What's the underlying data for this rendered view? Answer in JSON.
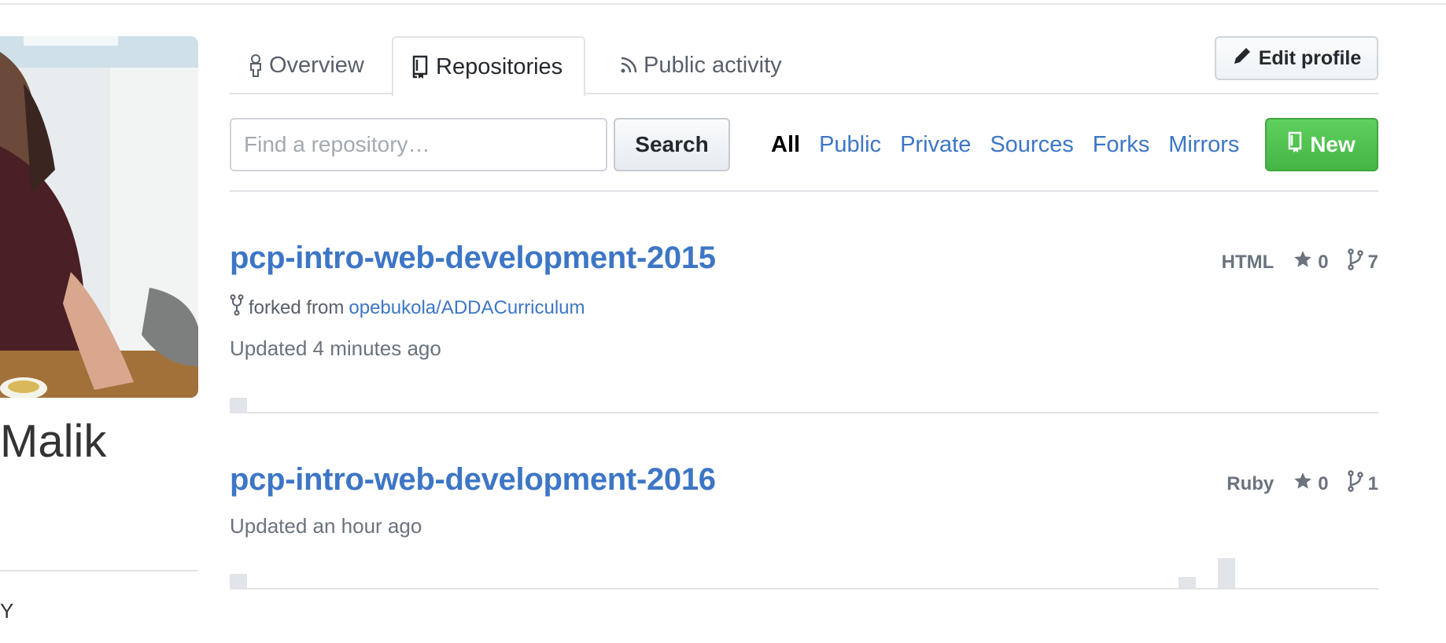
{
  "profile": {
    "name": "Malik",
    "bottom_text": "Y"
  },
  "tabs": [
    {
      "label": "Overview",
      "icon": "person-icon"
    },
    {
      "label": "Repositories",
      "icon": "repo-icon"
    },
    {
      "label": "Public activity",
      "icon": "rss-icon"
    }
  ],
  "edit_profile_label": "Edit profile",
  "search": {
    "placeholder": "Find a repository…",
    "button_label": "Search"
  },
  "filters": [
    "All",
    "Public",
    "Private",
    "Sources",
    "Forks",
    "Mirrors"
  ],
  "active_filter": "All",
  "new_button_label": "New",
  "colors": {
    "link": "#3d76c6",
    "new_button": "#4cbf4c",
    "muted": "#6a737d"
  },
  "repositories": [
    {
      "name": "pcp-intro-web-development-2015",
      "forked_prefix": "forked from",
      "forked_from": "opebukola/ADDACurriculum",
      "updated": "Updated 4 minutes ago",
      "language": "HTML",
      "stars": "0",
      "forks": "7"
    },
    {
      "name": "pcp-intro-web-development-2016",
      "updated": "Updated an hour ago",
      "language": "Ruby",
      "stars": "0",
      "forks": "1"
    }
  ]
}
